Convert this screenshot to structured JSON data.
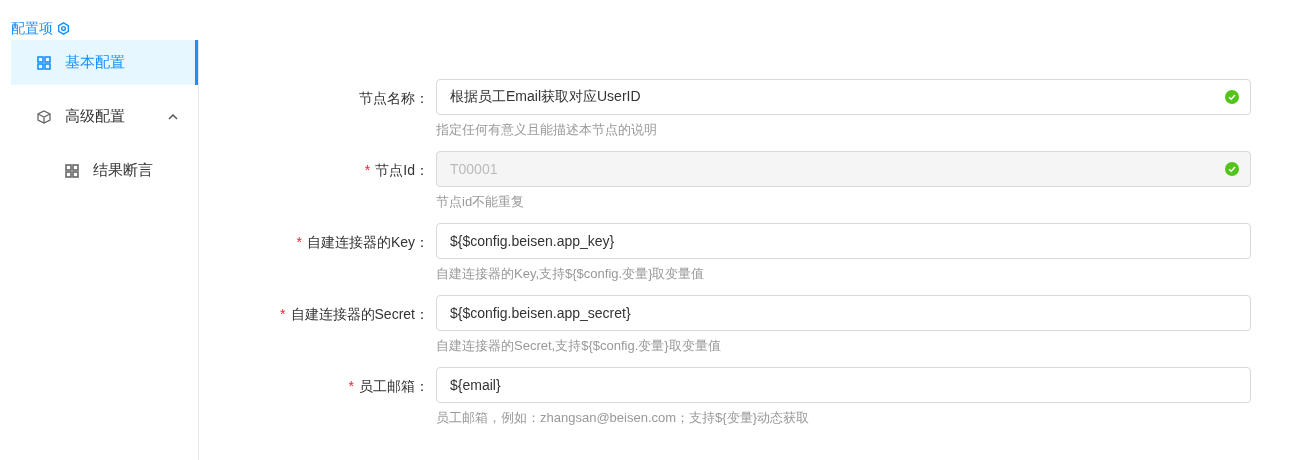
{
  "sidebar": {
    "title": "配置项",
    "items": [
      {
        "label": "基本配置",
        "kind": "grid",
        "selected": true
      },
      {
        "label": "高级配置",
        "kind": "cube",
        "selected": false,
        "expanded": true,
        "children": [
          {
            "label": "结果断言",
            "kind": "grid",
            "selected": false
          }
        ]
      }
    ]
  },
  "form": {
    "fields": [
      {
        "label": "节点名称：",
        "value": "根据员工Email获取对应UserID",
        "disabled": false,
        "valid": true,
        "help": "指定任何有意义且能描述本节点的说明"
      },
      {
        "required_mark": "*",
        "label": "节点Id：",
        "value": "T00001",
        "disabled": true,
        "valid": true,
        "help": "节点id不能重复"
      },
      {
        "required_mark": "*",
        "label": "自建连接器的Key：",
        "value": "${$config.beisen.app_key}",
        "disabled": false,
        "valid": false,
        "help": "自建连接器的Key,支持${$config.变量}取变量值"
      },
      {
        "required_mark": "*",
        "label": "自建连接器的Secret：",
        "value": "${$config.beisen.app_secret}",
        "disabled": false,
        "valid": false,
        "help": "自建连接器的Secret,支持${$config.变量}取变量值"
      },
      {
        "required_mark": "*",
        "label": "员工邮箱：",
        "value": "${email}",
        "disabled": false,
        "valid": false,
        "help": "员工邮箱，例如：zhangsan@beisen.com；支持${变量}动态获取"
      }
    ]
  }
}
